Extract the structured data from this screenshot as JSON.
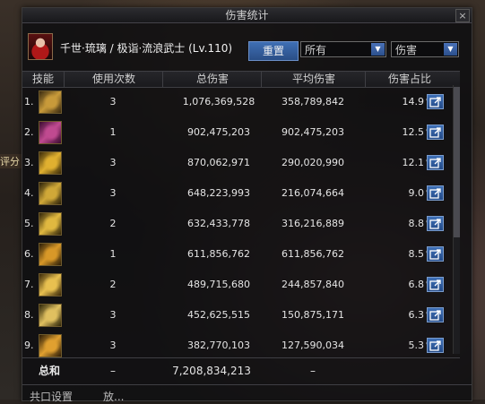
{
  "window": {
    "title": "伤害统计",
    "close_label": "×"
  },
  "character": {
    "name": "千世·琉璃 / 极诣·流浪武士 (Lv.110)"
  },
  "controls": {
    "reset_label": "重置",
    "filter_value": "所有",
    "metric_value": "伤害",
    "dropdown_arrow": "▼"
  },
  "columns": {
    "skill": "技能",
    "uses": "使用次数",
    "total": "总伤害",
    "avg": "平均伤害",
    "share": "伤害占比"
  },
  "rows": [
    {
      "idx": "1.",
      "uses": "3",
      "total": "1,076,369,528",
      "avg": "358,789,842",
      "pct": "14.9",
      "icon": "skill-icon-1",
      "colors": [
        "#3a2a10",
        "#c89a3a"
      ]
    },
    {
      "idx": "2.",
      "uses": "1",
      "total": "902,475,203",
      "avg": "902,475,203",
      "pct": "12.5",
      "icon": "skill-icon-2",
      "colors": [
        "#3a0a30",
        "#c04a90"
      ]
    },
    {
      "idx": "3.",
      "uses": "3",
      "total": "870,062,971",
      "avg": "290,020,990",
      "pct": "12.1",
      "icon": "skill-icon-3",
      "colors": [
        "#3a2a08",
        "#e0b030"
      ]
    },
    {
      "idx": "4.",
      "uses": "3",
      "total": "648,223,993",
      "avg": "216,074,664",
      "pct": "9.0",
      "icon": "skill-icon-4",
      "colors": [
        "#2a2008",
        "#d0a838"
      ]
    },
    {
      "idx": "5.",
      "uses": "2",
      "total": "632,433,778",
      "avg": "316,216,889",
      "pct": "8.8",
      "icon": "skill-icon-5",
      "colors": [
        "#302408",
        "#e0b840"
      ]
    },
    {
      "idx": "6.",
      "uses": "1",
      "total": "611,856,762",
      "avg": "611,856,762",
      "pct": "8.5",
      "icon": "skill-icon-6",
      "colors": [
        "#2a1c06",
        "#d89828"
      ]
    },
    {
      "idx": "7.",
      "uses": "2",
      "total": "489,715,680",
      "avg": "244,857,840",
      "pct": "6.8",
      "icon": "skill-icon-7",
      "colors": [
        "#3a2808",
        "#e8c050"
      ]
    },
    {
      "idx": "8.",
      "uses": "3",
      "total": "452,625,515",
      "avg": "150,875,171",
      "pct": "6.3",
      "icon": "skill-icon-8",
      "colors": [
        "#2c2408",
        "#e0c060"
      ]
    },
    {
      "idx": "9.",
      "uses": "3",
      "total": "382,770,103",
      "avg": "127,590,034",
      "pct": "5.3",
      "icon": "skill-icon-9",
      "colors": [
        "#2a1a06",
        "#e0a030"
      ]
    }
  ],
  "pct_symbol": "%",
  "totals": {
    "label": "总和",
    "uses": "–",
    "total": "7,208,834,213",
    "avg": "–"
  },
  "footer": {
    "left": "共口设置",
    "right": "放..."
  },
  "background_fragment": "评分"
}
